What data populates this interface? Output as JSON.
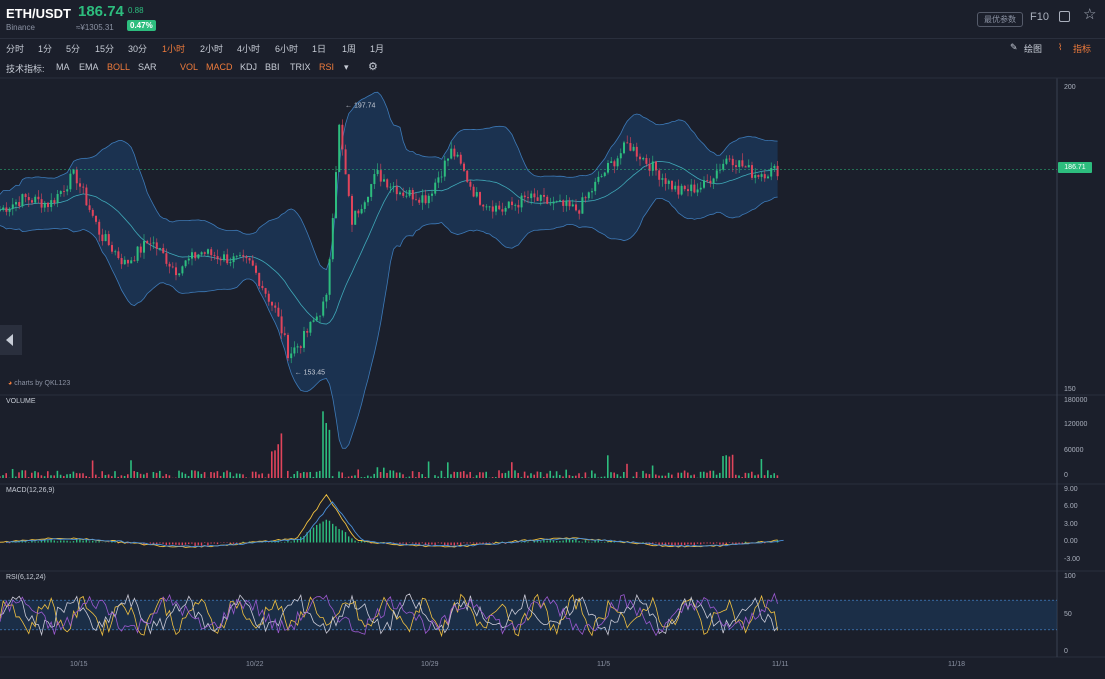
{
  "header": {
    "pair": "ETH/USDT",
    "exchange": "Binance",
    "price": "186.74",
    "change": "0.88",
    "cny_price": "≈¥1305.31",
    "change_pct": "0.47%",
    "options_label": "最优参数",
    "f10_label": "F10",
    "expand_icon": "expand-icon",
    "star_icon": "star-icon"
  },
  "timeframes": [
    "分时",
    "1分",
    "5分",
    "15分",
    "30分",
    "1小时",
    "2小时",
    "4小时",
    "6小时",
    "1日",
    "1周",
    "1月"
  ],
  "active_timeframe": "1小时",
  "toolbar": {
    "draw_label": "绘图",
    "indicator_label": "指标"
  },
  "indicators": {
    "label": "技术指标:",
    "items": [
      "MA",
      "EMA",
      "BOLL",
      "SAR",
      "VOL",
      "MACD",
      "KDJ",
      "BBI",
      "TRIX",
      "RSI"
    ],
    "active": [
      "BOLL",
      "VOL",
      "MACD",
      "RSI"
    ]
  },
  "panels": {
    "volume": "VOLUME",
    "macd": "MACD(12,26,9)",
    "rsi": "RSI(6,12,24)"
  },
  "watermark": "charts by QKL123",
  "colors": {
    "up": "#2dbd7e",
    "down": "#e0445b",
    "accent": "#ef7b3c",
    "background": "#1b1f2b",
    "boll_fill": "#1c3a5e"
  },
  "chart_data": [
    {
      "type": "candlestick",
      "indicator": "BOLL",
      "y_ticks": [
        "200",
        "150"
      ],
      "ylim": [
        150,
        200
      ],
      "current_price_tag": "186.71",
      "max_label": "197.74",
      "min_label": "153.45",
      "x_ticks": [
        "10/15",
        "10/22",
        "10/29",
        "11/5",
        "11/11",
        "11/18"
      ],
      "approx_close_path": [
        {
          "x": "10/12",
          "y": 180
        },
        {
          "x": "10/13",
          "y": 182
        },
        {
          "x": "10/14",
          "y": 181
        },
        {
          "x": "10/15",
          "y": 186
        },
        {
          "x": "10/16",
          "y": 176
        },
        {
          "x": "10/17",
          "y": 171
        },
        {
          "x": "10/18",
          "y": 175
        },
        {
          "x": "10/19",
          "y": 170
        },
        {
          "x": "10/20",
          "y": 173
        },
        {
          "x": "10/21",
          "y": 172
        },
        {
          "x": "10/22",
          "y": 171
        },
        {
          "x": "10/23",
          "y": 163
        },
        {
          "x": "10/23 12h",
          "y": 156
        },
        {
          "x": "10/24",
          "y": 158
        },
        {
          "x": "10/25",
          "y": 165
        },
        {
          "x": "10/25 12h",
          "y": 194
        },
        {
          "x": "10/26",
          "y": 178
        },
        {
          "x": "10/27",
          "y": 186
        },
        {
          "x": "10/28",
          "y": 183
        },
        {
          "x": "10/29",
          "y": 182
        },
        {
          "x": "10/30",
          "y": 190
        },
        {
          "x": "10/31",
          "y": 182
        },
        {
          "x": "11/1",
          "y": 180
        },
        {
          "x": "11/2",
          "y": 182
        },
        {
          "x": "11/3",
          "y": 181
        },
        {
          "x": "11/4",
          "y": 180
        },
        {
          "x": "11/5",
          "y": 186
        },
        {
          "x": "11/6",
          "y": 191
        },
        {
          "x": "11/7",
          "y": 187
        },
        {
          "x": "11/8",
          "y": 183
        },
        {
          "x": "11/9",
          "y": 184
        },
        {
          "x": "11/10",
          "y": 189
        },
        {
          "x": "11/11",
          "y": 186
        },
        {
          "x": "11/12",
          "y": 186.71
        }
      ]
    },
    {
      "type": "bar",
      "indicator": "VOLUME",
      "y_ticks": [
        "180000",
        "120000",
        "60000",
        "0"
      ],
      "ylim": [
        0,
        180000
      ],
      "spikes": [
        {
          "x": "10/25",
          "y": 170000
        },
        {
          "x": "10/23",
          "y": 90000
        },
        {
          "x": "11/10",
          "y": 70000
        }
      ]
    },
    {
      "type": "line",
      "indicator": "MACD",
      "y_ticks": [
        "9.00",
        "6.00",
        "3.00",
        "0.00",
        "-3.00"
      ],
      "ylim": [
        -3,
        9
      ],
      "peak": {
        "x": "10/25",
        "y": 7.5
      }
    },
    {
      "type": "line",
      "indicator": "RSI",
      "y_ticks": [
        "100",
        "50",
        "0"
      ],
      "ylim": [
        0,
        100
      ],
      "bands": [
        30,
        70
      ]
    }
  ]
}
